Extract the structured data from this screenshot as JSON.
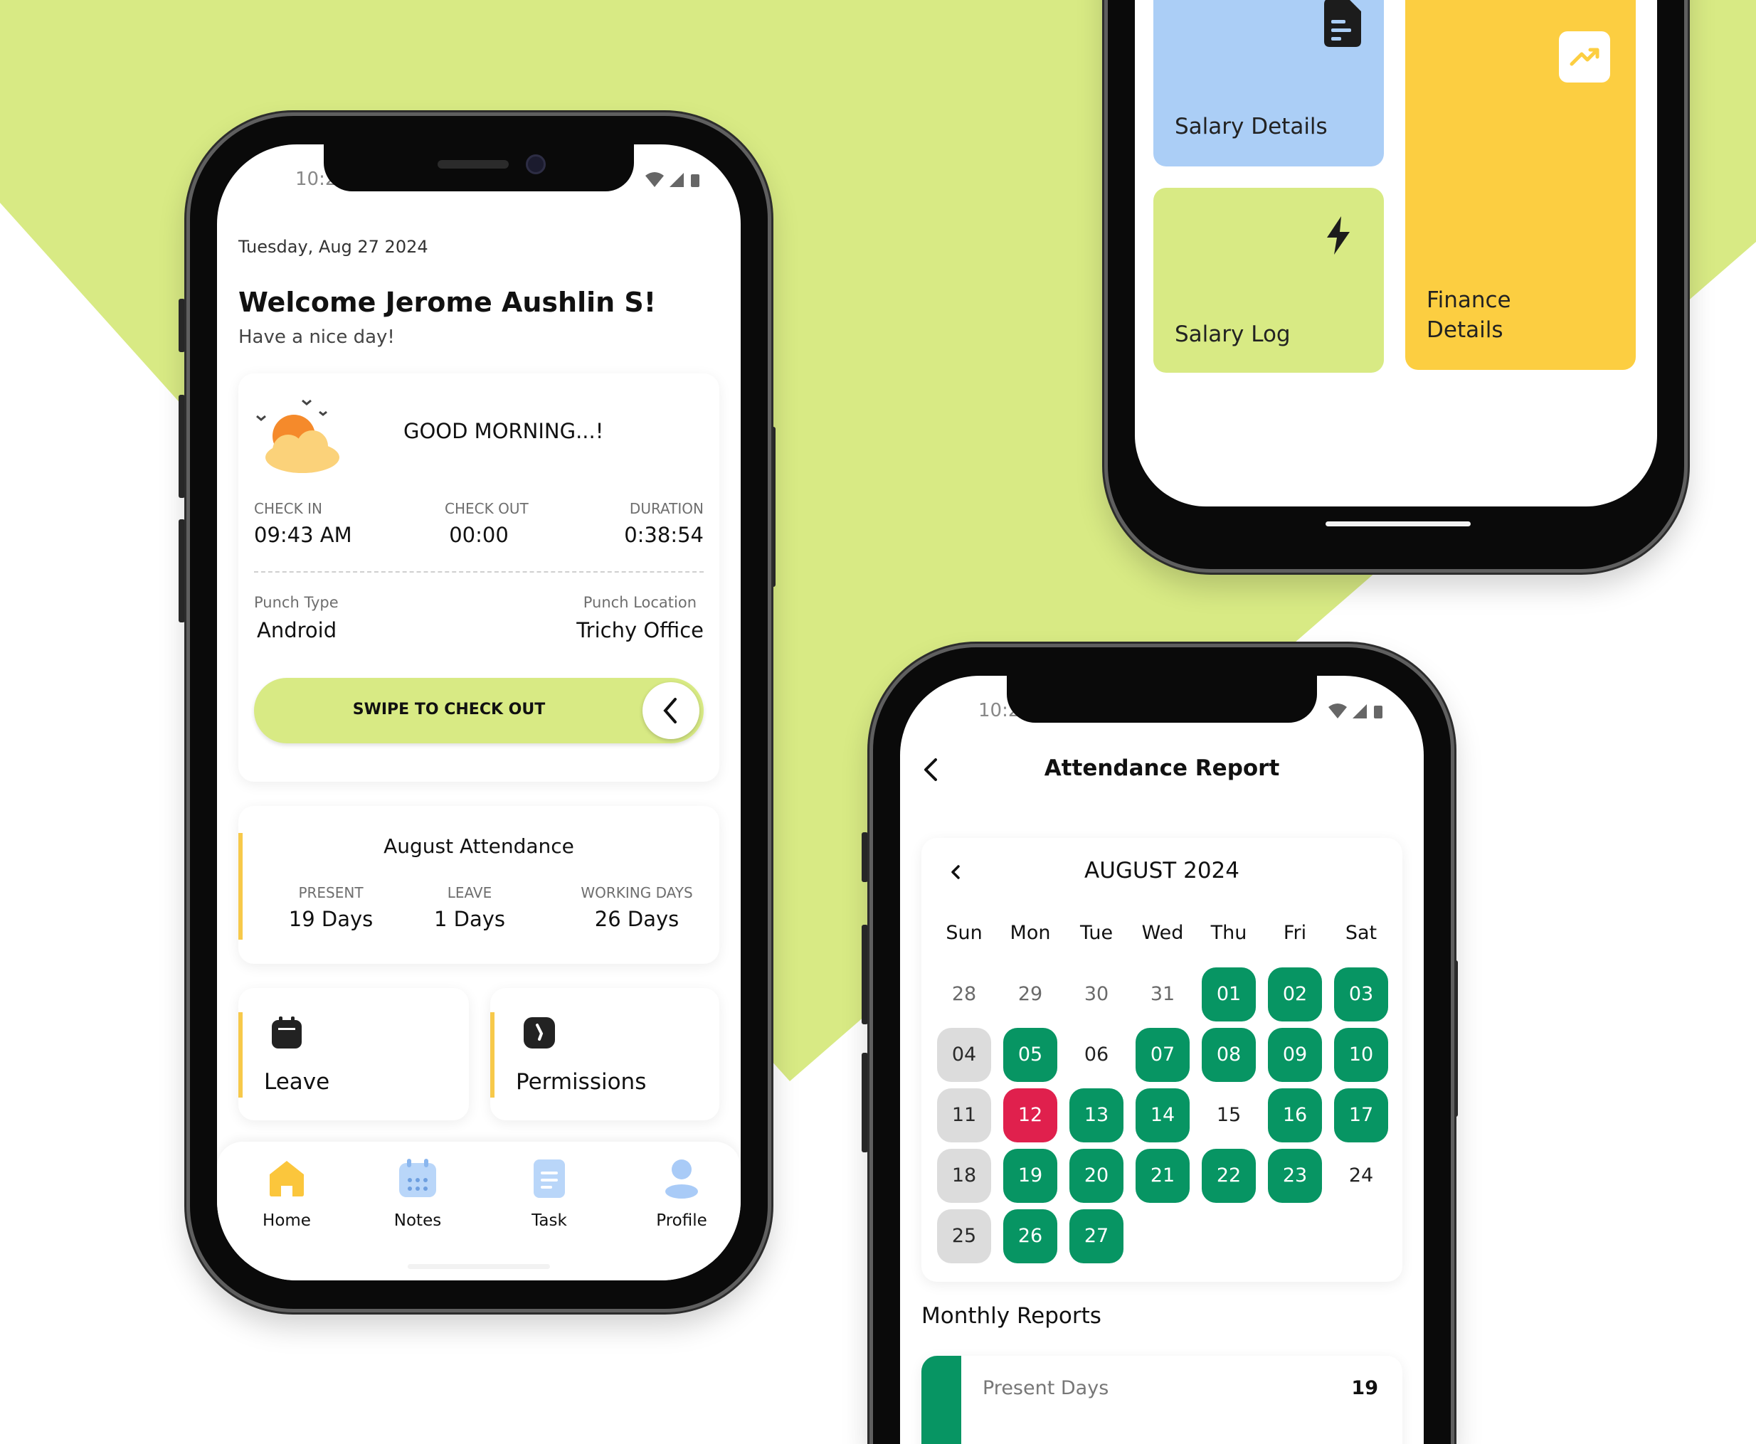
{
  "colors": {
    "lime": "#d8ea84",
    "present_green": "#079563",
    "absent_red": "#e0204d",
    "salary_blue": "#abcef6",
    "finance_yellow": "#fcce41",
    "accent_yellow": "#f7c94a"
  },
  "home_screen": {
    "status_time": "10:2",
    "date": "Tuesday, Aug 27 2024",
    "welcome": "Welcome Jerome Aushlin S!",
    "subtitle": "Have a nice day!",
    "greeting": "GOOD MORNING...!",
    "check_in_label": "CHECK IN",
    "check_in_value": "09:43 AM",
    "check_out_label": "CHECK OUT",
    "check_out_value": "00:00",
    "duration_label": "DURATION",
    "duration_value": "0:38:54",
    "punch_type_label": "Punch Type",
    "punch_type_value": "Android",
    "punch_location_label": "Punch Location",
    "punch_location_value": "Trichy Office",
    "swipe_label": "SWIPE TO CHECK OUT",
    "attendance": {
      "title": "August Attendance",
      "present_label": "PRESENT",
      "present_value": "19 Days",
      "leave_label": "LEAVE",
      "leave_value": "1 Days",
      "working_label": "WORKING DAYS",
      "working_value": "26 Days"
    },
    "tiles": {
      "leave": "Leave",
      "permissions": "Permissions"
    },
    "nav": {
      "home": "Home",
      "notes": "Notes",
      "task": "Task",
      "profile": "Profile"
    }
  },
  "finance_screen": {
    "salary_details": "Salary Details",
    "salary_log": "Salary Log",
    "finance_details_line1": "Finance",
    "finance_details_line2": "Details"
  },
  "report_screen": {
    "status_time": "10:2",
    "title": "Attendance Report",
    "month": "AUGUST 2024",
    "weekdays": [
      "Sun",
      "Mon",
      "Tue",
      "Wed",
      "Thu",
      "Fri",
      "Sat"
    ],
    "days": [
      {
        "d": "28",
        "s": "o"
      },
      {
        "d": "29",
        "s": "o"
      },
      {
        "d": "30",
        "s": "o"
      },
      {
        "d": "31",
        "s": "o"
      },
      {
        "d": "01",
        "s": "p"
      },
      {
        "d": "02",
        "s": "p"
      },
      {
        "d": "03",
        "s": "p"
      },
      {
        "d": "04",
        "s": "h"
      },
      {
        "d": "05",
        "s": "p"
      },
      {
        "d": "06",
        "s": "n"
      },
      {
        "d": "07",
        "s": "p"
      },
      {
        "d": "08",
        "s": "p"
      },
      {
        "d": "09",
        "s": "p"
      },
      {
        "d": "10",
        "s": "p"
      },
      {
        "d": "11",
        "s": "h"
      },
      {
        "d": "12",
        "s": "a"
      },
      {
        "d": "13",
        "s": "p"
      },
      {
        "d": "14",
        "s": "p"
      },
      {
        "d": "15",
        "s": "n"
      },
      {
        "d": "16",
        "s": "p"
      },
      {
        "d": "17",
        "s": "p"
      },
      {
        "d": "18",
        "s": "h"
      },
      {
        "d": "19",
        "s": "p"
      },
      {
        "d": "20",
        "s": "p"
      },
      {
        "d": "21",
        "s": "p"
      },
      {
        "d": "22",
        "s": "p"
      },
      {
        "d": "23",
        "s": "p"
      },
      {
        "d": "24",
        "s": "n"
      },
      {
        "d": "25",
        "s": "h"
      },
      {
        "d": "26",
        "s": "p"
      },
      {
        "d": "27",
        "s": "p"
      }
    ],
    "monthly_reports": "Monthly Reports",
    "present_days_label": "Present Days",
    "present_days_value": "19"
  }
}
